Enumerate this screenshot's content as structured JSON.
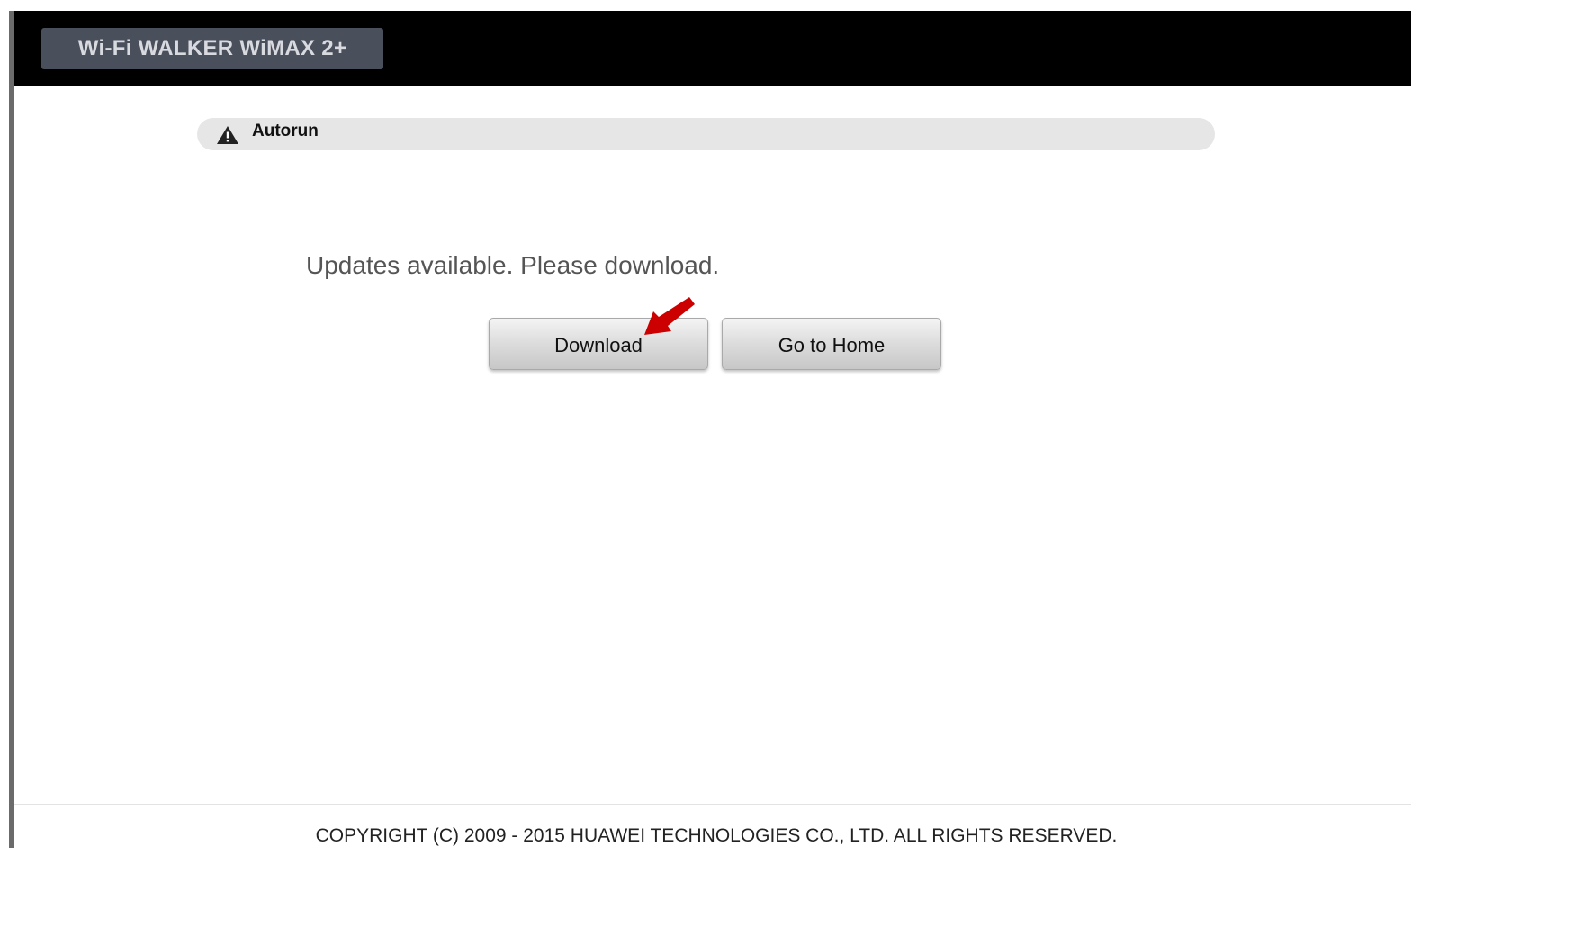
{
  "header": {
    "brand": "Wi-Fi WALKER WiMAX 2+"
  },
  "section": {
    "title": "Autorun",
    "icon": "warning-icon"
  },
  "main": {
    "message": "Updates available. Please download.",
    "download_label": "Download",
    "home_label": "Go to Home"
  },
  "annotation": {
    "arrow_icon": "red-arrow-icon",
    "arrow_color": "#cc0000"
  },
  "footer": {
    "copyright": "COPYRIGHT (C) 2009 - 2015 HUAWEI TECHNOLOGIES CO., LTD. ALL RIGHTS RESERVED."
  },
  "colors": {
    "header_bg": "#000000",
    "logo_bg": "#4a4f5c",
    "section_bar_bg": "#e6e6e6"
  }
}
